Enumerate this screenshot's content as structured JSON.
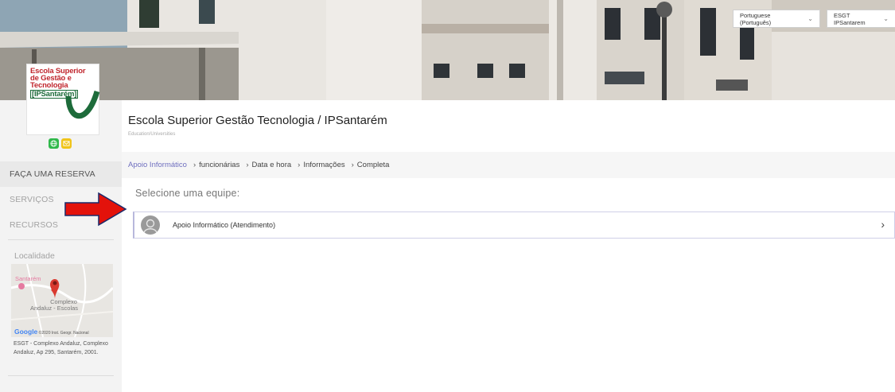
{
  "header": {
    "language_select": "Portuguese (Português)",
    "account_select": "ESGT IPSantarem"
  },
  "logo": {
    "lines": [
      "Escola Superior",
      "de Gestão e",
      "Tecnologia",
      "[IPSantarém]"
    ]
  },
  "company": {
    "title": "Escola Superior Gestão Tecnologia / IPSantarém",
    "category": "Education/Universities"
  },
  "sidebar": {
    "items": [
      {
        "label": "FAÇA UMA RESERVA",
        "active": true
      },
      {
        "label": "SERVIÇOS",
        "active": false
      },
      {
        "label": "RECURSOS",
        "active": false
      }
    ],
    "location_title": "Localidade",
    "map": {
      "city_label": "Santarém",
      "place_label_1": "Complexo",
      "place_label_2": "Andaluz - Escolas",
      "google": "Google",
      "credit": "©2020 Inst. Geogr. Nacional"
    },
    "address": "ESGT - Complexo Andaluz, Complexo Andaluz, Ap 295, Santarém, 2001."
  },
  "breadcrumbs": [
    {
      "label": "Apoio Informático"
    },
    {
      "label": "funcionárias"
    },
    {
      "label": "Data e hora"
    },
    {
      "label": "Informações"
    },
    {
      "label": "Completa"
    }
  ],
  "main": {
    "select_title": "Selecione uma equipe:",
    "teams": [
      {
        "label": "Apoio Informático (Atendimento)"
      }
    ]
  },
  "colors": {
    "accent": "#6f6fbf",
    "arrow": "#e3120b",
    "logo_red": "#c0262d",
    "logo_green": "#1d6b3a"
  }
}
